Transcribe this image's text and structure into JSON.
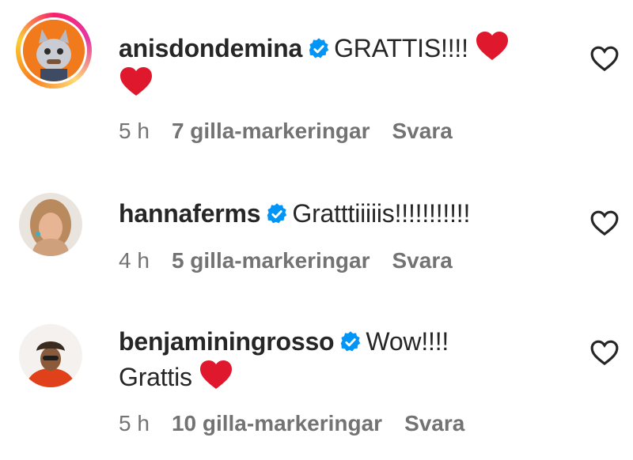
{
  "comments": [
    {
      "username": "anisdondemina",
      "text_line1": "GRATTIS!!!!",
      "text_line2": "",
      "time": "5 h",
      "likes": "7 gilla-markeringar",
      "reply": "Svara",
      "has_story": true
    },
    {
      "username": "hannaferms",
      "text_line1": "Gratttiiiiis!!!!!!!!!!!",
      "text_line2": "",
      "time": "4 h",
      "likes": "5 gilla-markeringar",
      "reply": "Svara",
      "has_story": false
    },
    {
      "username": "benjaminingrosso",
      "text_line1": "Wow!!!!",
      "text_line2": "Grattis",
      "time": "5 h",
      "likes": "10 gilla-markeringar",
      "reply": "Svara",
      "has_story": false
    }
  ],
  "icons": {
    "verified": "verified-badge-icon",
    "heart_emoji": "red-heart-emoji",
    "like": "heart-outline-icon"
  },
  "colors": {
    "verified_blue": "#0095f6",
    "meta_gray": "#737373",
    "heart_red": "#e0182d"
  }
}
